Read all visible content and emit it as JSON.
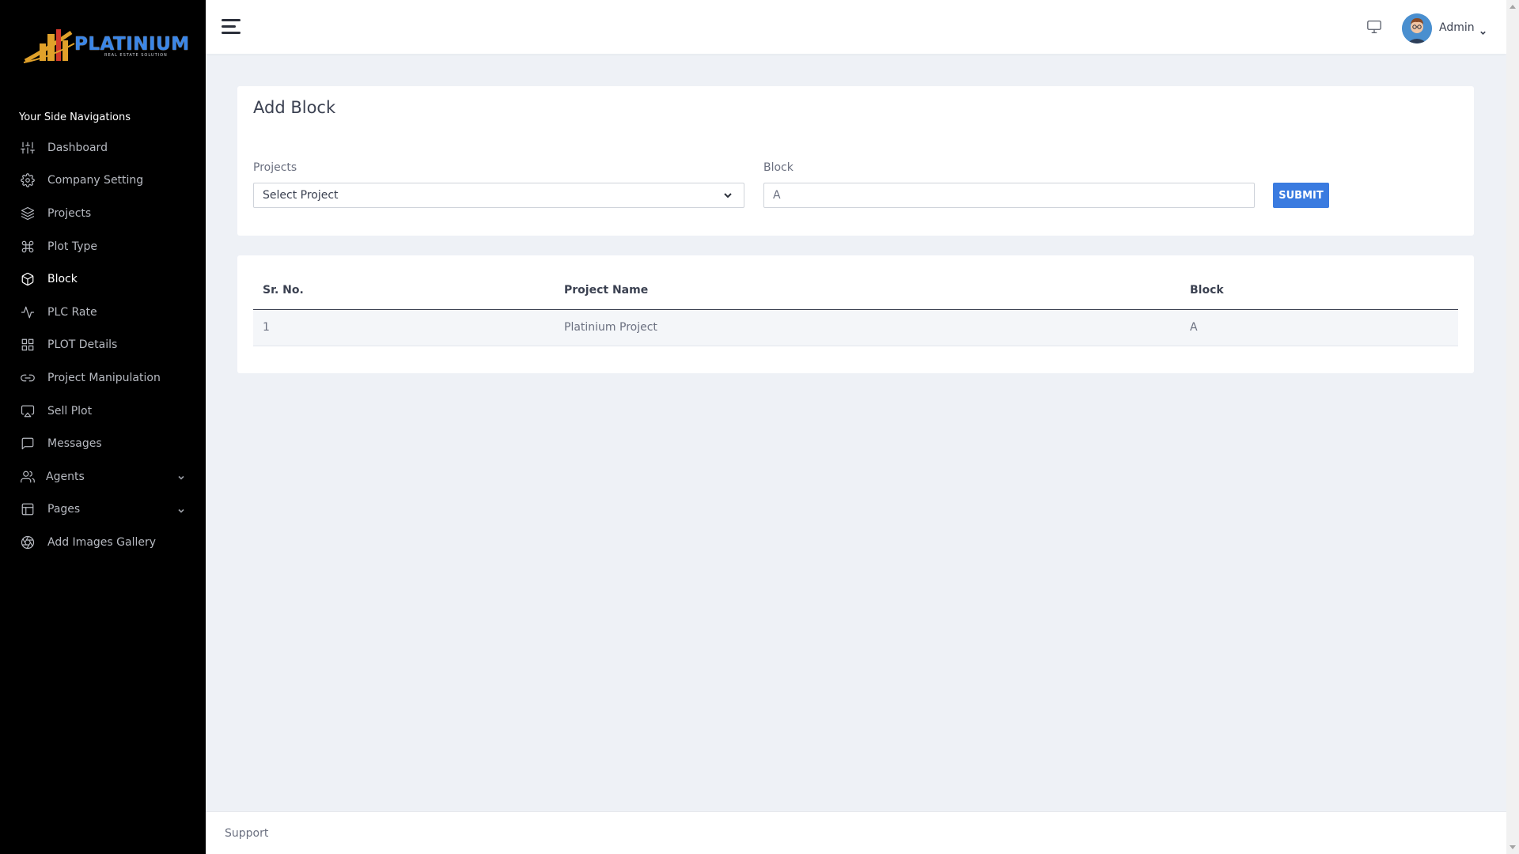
{
  "brand": {
    "name": "PLATINIUM",
    "tagline": "REAL ESTATE SOLUTION",
    "logo_colors": {
      "gold": "#e0a12a",
      "red": "#d4392a",
      "blue": "#3a86e8"
    }
  },
  "sidebar": {
    "heading": "Your Side Navigations",
    "items": [
      {
        "label": "Dashboard",
        "icon": "sliders-icon"
      },
      {
        "label": "Company Setting",
        "icon": "gear-icon"
      },
      {
        "label": "Projects",
        "icon": "layers-icon"
      },
      {
        "label": "Plot Type",
        "icon": "command-icon"
      },
      {
        "label": "Block",
        "icon": "box-icon",
        "active": true
      },
      {
        "label": "PLC Rate",
        "icon": "activity-icon"
      },
      {
        "label": "PLOT Details",
        "icon": "grid-icon"
      },
      {
        "label": "Project Manipulation",
        "icon": "link-icon"
      },
      {
        "label": "Sell Plot",
        "icon": "airplay-icon"
      },
      {
        "label": "Messages",
        "icon": "message-square-icon"
      },
      {
        "label": "Agents",
        "icon": "users-icon",
        "expandable": true
      },
      {
        "label": "Pages",
        "icon": "layout-icon",
        "expandable": true
      },
      {
        "label": "Add Images Gallery",
        "icon": "aperture-icon"
      }
    ]
  },
  "header": {
    "user_name": "Admin",
    "icons": [
      "menu-icon",
      "monitor-icon",
      "avatar",
      "chevron-down-icon"
    ]
  },
  "form": {
    "title": "Add Block",
    "projects_label": "Projects",
    "projects_selected": "Select Project",
    "block_label": "Block",
    "block_value": "A",
    "submit_label": "SUBMIT"
  },
  "table": {
    "headers": [
      "Sr. No.",
      "Project Name",
      "Block"
    ],
    "rows": [
      [
        "1",
        "Platinium Project",
        "A"
      ]
    ]
  },
  "footer": {
    "text": "Support"
  },
  "colors": {
    "accent": "#3a7be0",
    "sidebar_bg": "#000000",
    "page_bg": "#eef1f6"
  }
}
